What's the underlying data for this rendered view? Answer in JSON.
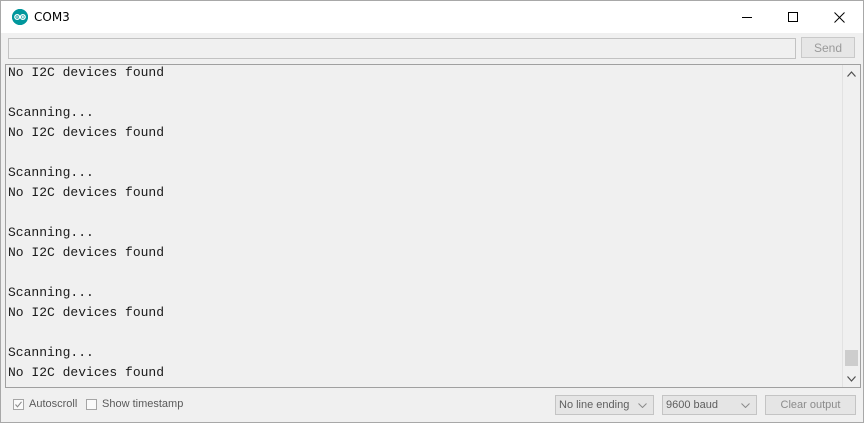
{
  "window": {
    "title": "COM3",
    "app_icon": "arduino-icon",
    "controls": [
      "minimize-icon",
      "maximize-icon",
      "close-icon"
    ]
  },
  "send_bar": {
    "input_value": "",
    "send_label": "Send"
  },
  "output": {
    "lines": [
      "No I2C devices found",
      "",
      "Scanning...",
      "No I2C devices found",
      "",
      "Scanning...",
      "No I2C devices found",
      "",
      "Scanning...",
      "No I2C devices found",
      "",
      "Scanning...",
      "No I2C devices found",
      "",
      "Scanning...",
      "No I2C devices found"
    ]
  },
  "footer": {
    "autoscroll": {
      "label": "Autoscroll",
      "checked": true
    },
    "timestamp": {
      "label": "Show timestamp",
      "checked": false
    },
    "line_ending": "No line ending",
    "baud": "9600 baud",
    "clear_label": "Clear output"
  },
  "colors": {
    "accent": "#00979c"
  }
}
